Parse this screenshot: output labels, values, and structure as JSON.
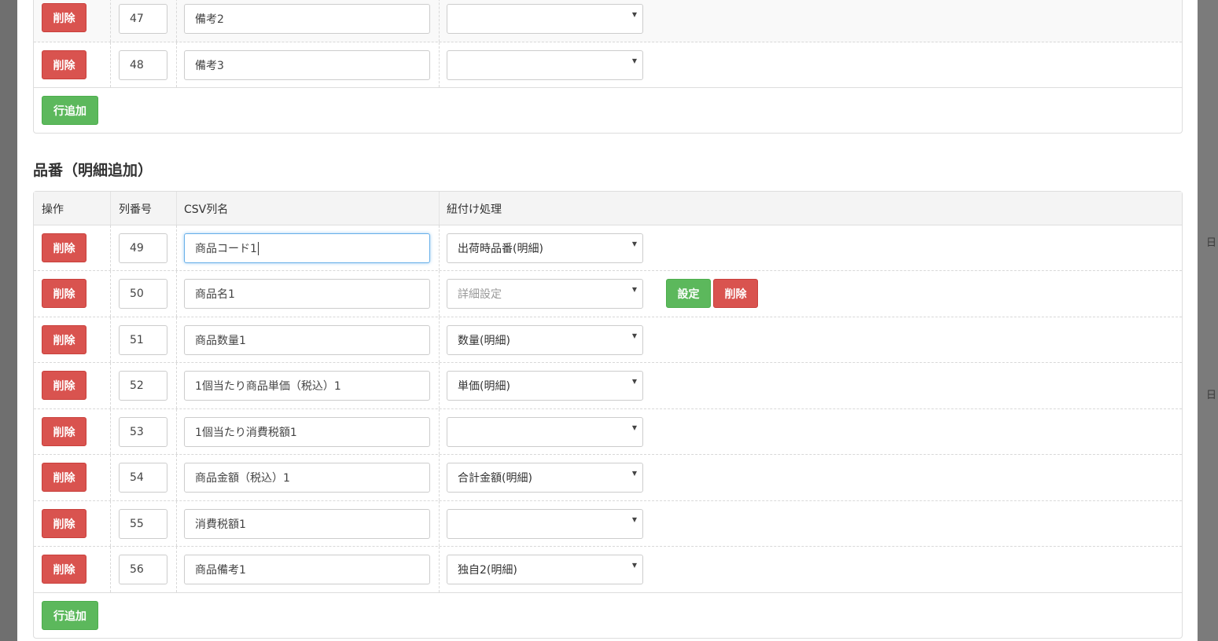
{
  "backdrop": {
    "right_text_1": "日",
    "right_text_2": "日"
  },
  "top_table": {
    "rows": [
      {
        "delete_label": "削除",
        "column_number": "47",
        "csv_name": "備考2",
        "mapping": ""
      },
      {
        "delete_label": "削除",
        "column_number": "48",
        "csv_name": "備考3",
        "mapping": ""
      }
    ],
    "add_row_label": "行追加"
  },
  "section": {
    "title": "品番（明細追加）"
  },
  "detail_table": {
    "headers": {
      "operation": "操作",
      "column_number": "列番号",
      "csv_name": "CSV列名",
      "mapping": "紐付け処理"
    },
    "rows": [
      {
        "delete_label": "削除",
        "column_number": "49",
        "csv_name": "商品コード1",
        "mapping": "出荷時品番(明細)"
      },
      {
        "delete_label": "削除",
        "column_number": "50",
        "csv_name": "商品名1",
        "mapping": "詳細設定",
        "set_label": "設定",
        "extra_delete_label": "削除"
      },
      {
        "delete_label": "削除",
        "column_number": "51",
        "csv_name": "商品数量1",
        "mapping": "数量(明細)"
      },
      {
        "delete_label": "削除",
        "column_number": "52",
        "csv_name": "1個当たり商品単価（税込）1",
        "mapping": "単価(明細)"
      },
      {
        "delete_label": "削除",
        "column_number": "53",
        "csv_name": "1個当たり消費税額1",
        "mapping": ""
      },
      {
        "delete_label": "削除",
        "column_number": "54",
        "csv_name": "商品金額（税込）1",
        "mapping": "合計金額(明細)"
      },
      {
        "delete_label": "削除",
        "column_number": "55",
        "csv_name": "消費税額1",
        "mapping": ""
      },
      {
        "delete_label": "削除",
        "column_number": "56",
        "csv_name": "商品備考1",
        "mapping": "独自2(明細)"
      }
    ],
    "add_row_label": "行追加"
  },
  "colors": {
    "danger": "#d9534f",
    "success": "#5cb85c",
    "focus": "#66afe9"
  },
  "icons": {
    "select_arrow": "caret-down-icon"
  }
}
